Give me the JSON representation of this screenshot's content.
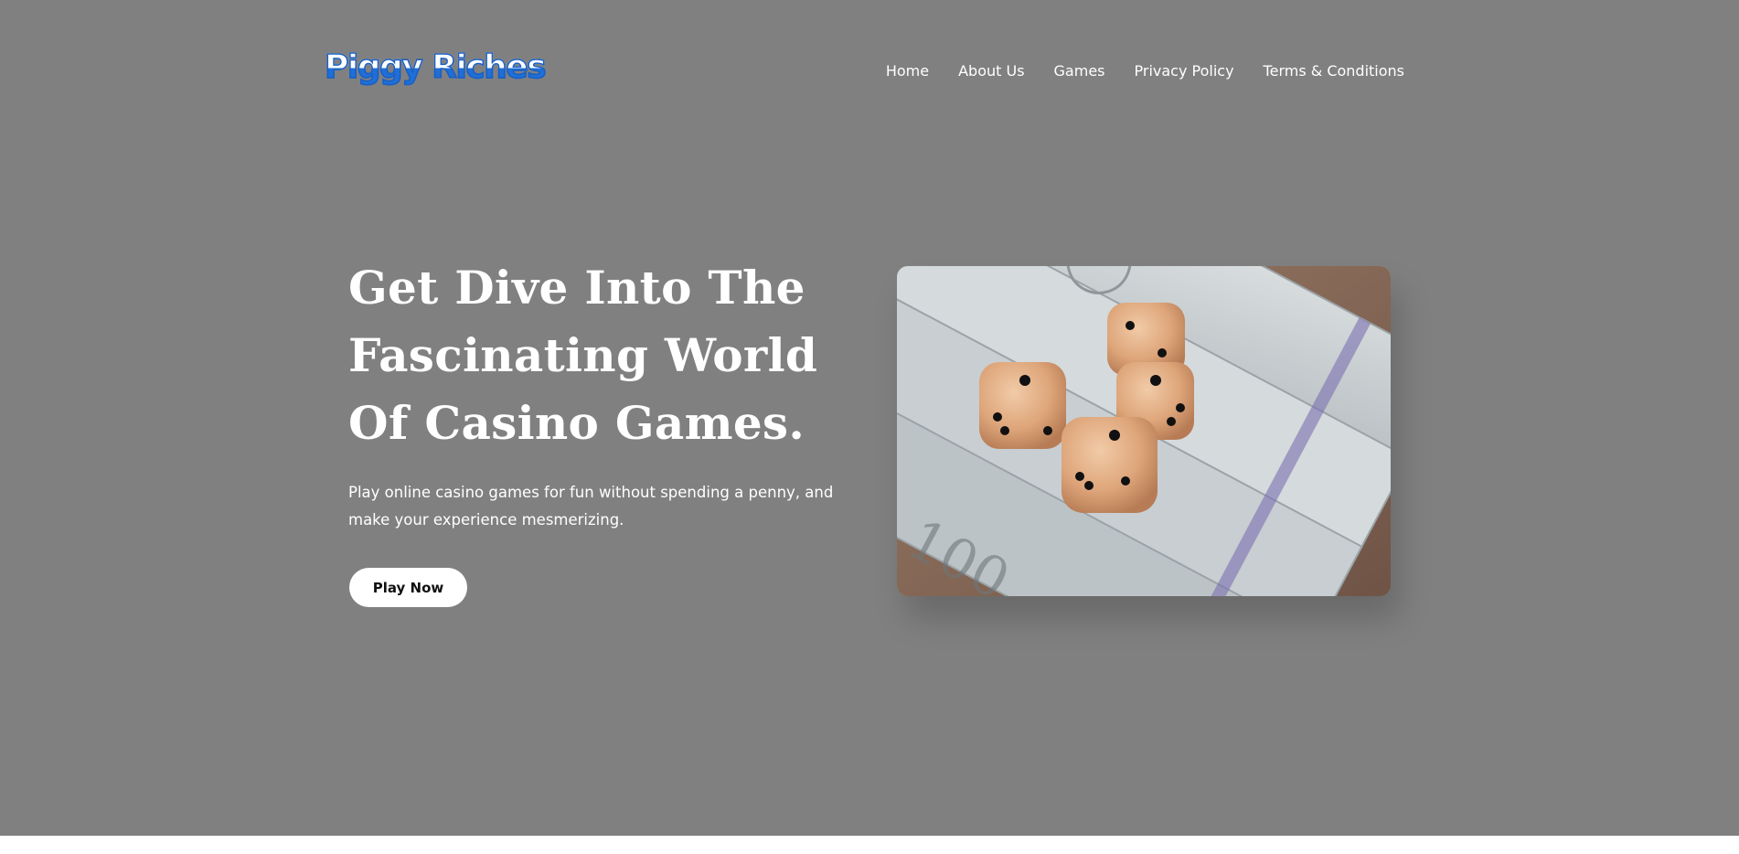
{
  "brand": {
    "logo_text": "Piggy Riches"
  },
  "nav": {
    "items": [
      {
        "label": "Home"
      },
      {
        "label": "About Us"
      },
      {
        "label": "Games"
      },
      {
        "label": "Privacy Policy"
      },
      {
        "label": "Terms & Conditions"
      }
    ]
  },
  "hero": {
    "headline_line1": "Get Dive Into The",
    "headline_line2": "Fascinating World",
    "headline_line3": "Of Casino Games.",
    "subtitle": "Play online casino games for fun without spending a penny, and make your experience mesmerizing.",
    "cta_label": "Play Now",
    "image_alt": "dice-on-dollar-bills"
  },
  "colors": {
    "background": "#808080",
    "text": "#ffffff",
    "logo_accent": "#1f6fd6",
    "button_bg": "#ffffff",
    "button_text": "#111111"
  }
}
